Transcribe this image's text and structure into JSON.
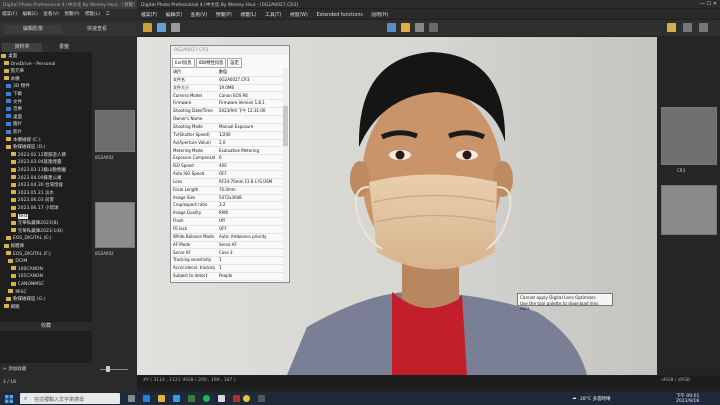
{
  "left_window": {
    "title": "Digital Photo Professional 4 (中文化 By Wesley Hsu) - [瀏覽]",
    "menu": [
      "檔案(F)",
      "編輯(E)",
      "查看(V)",
      "預覽(P)",
      "標籤(L)",
      "工"
    ],
    "tabs": [
      "編輯影像",
      "快速查看"
    ],
    "tree_tabs": [
      "資料夾",
      "書籤"
    ],
    "tree": [
      "桌面",
      "OneDrive - Personal",
      "張元華",
      "本機",
      "3D 物件",
      "下載",
      "文件",
      "音樂",
      "桌面",
      "圖片",
      "影片",
      "本機磁碟 (C:)",
      "軟碟磁碟區 (D:)",
      "2023.02.12南部遊人節",
      "2023.03.04基隆煙臺",
      "2023.03.11藝山動物園",
      "2023.04.09蘇墨公寓",
      "2023.04.30 台灣燈會",
      "2023.05.21 淡水",
      "2023.06.03 前景",
      "2023.06.17 小琉球",
      "test",
      "元華私藏庫2023(B)",
      "元華私藏庫2023-1(B)",
      "EOS_DIGITAL (E:)",
      "媒體庫",
      "EOS_DIGITAL (F:)",
      "DCIM",
      "100CANON",
      "101CANON",
      "CANONMSC",
      "MISC",
      "軟碟磁碟區 (G:)",
      "網路"
    ],
    "selected_folder": "test",
    "panel_title": "收藏",
    "add_label": "+ 添加收藏",
    "counter": "1 / 18"
  },
  "main_window": {
    "title": "Digital Photo Professional 4 (中文化 By Wesley Hsu) - [0G2A0027.CR3]",
    "menu": [
      "檔案(F)",
      "編輯(E)",
      "查看(V)",
      "預覽(P)",
      "標籤(L)",
      "工具(T)",
      "視窗(W)",
      "Extended functions",
      "說明(H)"
    ],
    "thumb_labels": [
      "0G2A002",
      "0G2A002",
      "CR3"
    ],
    "status": "XY ( 3114 , 1121 )RGB ( 200 , 199 , 187 )",
    "srgb": "sRGB / sRGB"
  },
  "info_dialog": {
    "header": "0G2A0027.CR3",
    "tabs": [
      "Exif訊息",
      "IDB特性訊息",
      "設定"
    ],
    "rows": [
      [
        "項目",
        "數值"
      ],
      [
        "文件名",
        "0G2A0027.CR3"
      ],
      [
        "文件大小",
        "19.0MB"
      ],
      [
        "Camera Model",
        "Canon EOS R6"
      ],
      [
        "Firmware",
        "Firmware Version 1.8.1"
      ],
      [
        "Shooting Date/Time",
        "2023/9/4 下午 12:31:00"
      ],
      [
        "Owner's Name",
        ""
      ],
      [
        "Shooting Mode",
        "Manual Exposure"
      ],
      [
        "Tv(Shutter Speed)",
        "1/200"
      ],
      [
        "Av(Aperture Value)",
        "2.0"
      ],
      [
        "Metering Mode",
        "Evaluative Metering"
      ],
      [
        "Exposure Compensati..",
        "0"
      ],
      [
        "ISO Speed",
        "400"
      ],
      [
        "Auto ISO Speed",
        "OFF"
      ],
      [
        "Lens",
        "RF24-70mm F2.8 L IS USM"
      ],
      [
        "Focal Length",
        "70.0mm"
      ],
      [
        "Image Size",
        "5472x3648"
      ],
      [
        "Crop/aspect ratio",
        "3:2"
      ],
      [
        "Image Quality",
        "RAW"
      ],
      [
        "Flash",
        "Off"
      ],
      [
        "FE lock",
        "OFF"
      ],
      [
        "White Balance Mode",
        "Auto: Ambience priority"
      ],
      [
        "AF Mode",
        "Servo AF"
      ],
      [
        "Servo AF",
        "Case 3"
      ],
      [
        "Tracking sensitivity",
        "1"
      ],
      [
        "Accel./decel. tracking",
        "1"
      ],
      [
        "Subject to detect",
        "People"
      ]
    ]
  },
  "tooltip": {
    "line1": "Cannot apply Digital Lens Optimizer.",
    "line2": "Use the tool palette to download lens data."
  },
  "taskbar": {
    "search_placeholder": "在這裡輸入文字來搜尋",
    "weather": "28°C 多雲時晴",
    "time": "下午 09:01",
    "date": "2023/9/18"
  }
}
